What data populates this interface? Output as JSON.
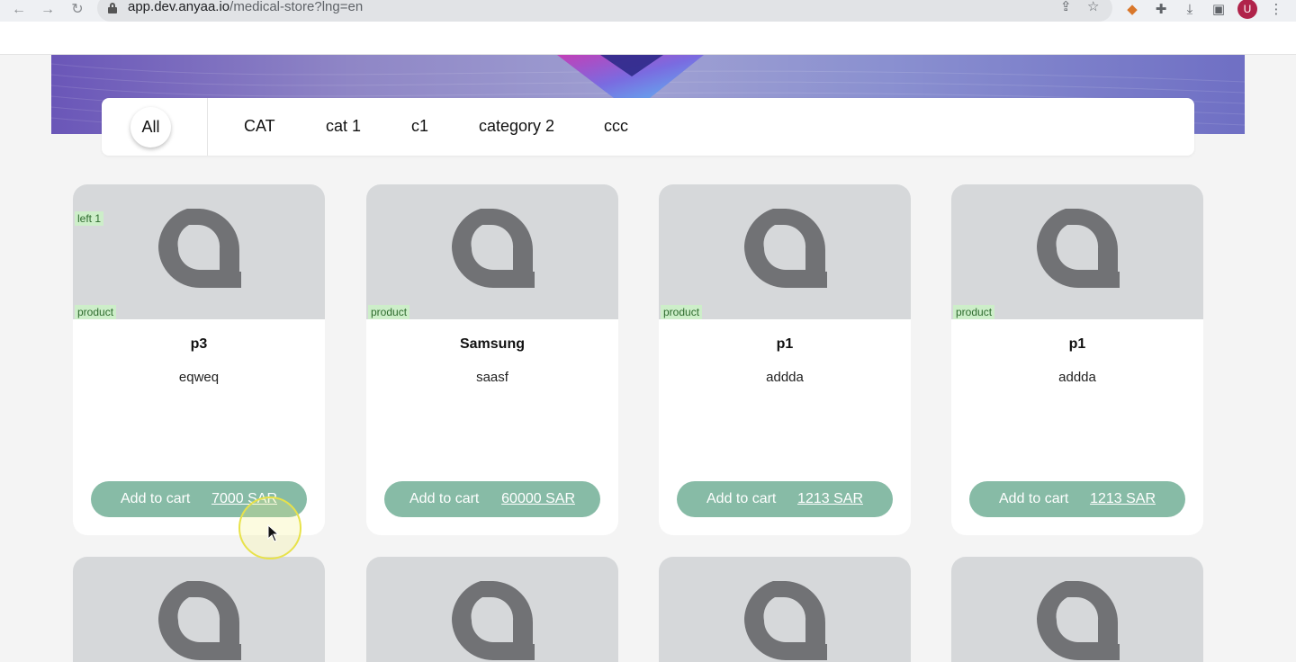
{
  "browser": {
    "url_host": "app.dev.anyaa.io",
    "url_path": "/medical-store?lng=en",
    "avatar_letter": "U",
    "icons": [
      "back-arrow-icon",
      "forward-arrow-icon",
      "reload-icon",
      "lock-icon",
      "share-icon",
      "star-icon",
      "fox-extension-icon",
      "puzzle-extension-icon",
      "download-icon",
      "side-panel-icon",
      "kebab-menu-icon"
    ]
  },
  "categories": {
    "selected": "All",
    "items": [
      "CAT",
      "cat 1",
      "c1",
      "category 2",
      "ccc"
    ]
  },
  "products": [
    {
      "stock_badge": "left 1",
      "type_badge": "product",
      "title": "p3",
      "description": "eqweq",
      "cart_label": "Add to cart",
      "price": "7000 SAR"
    },
    {
      "stock_badge": "",
      "type_badge": "product",
      "title": "Samsung",
      "description": "saasf",
      "cart_label": "Add to cart",
      "price": "60000 SAR"
    },
    {
      "stock_badge": "",
      "type_badge": "product",
      "title": "p1",
      "description": "addda",
      "cart_label": "Add to cart",
      "price": "1213 SAR"
    },
    {
      "stock_badge": "",
      "type_badge": "product",
      "title": "p1",
      "description": "addda",
      "cart_label": "Add to cart",
      "price": "1213 SAR"
    }
  ],
  "colors": {
    "cart_button": "#87bba6",
    "badge_bg": "#cdeec9",
    "badge_text": "#2e6b2e",
    "image_placeholder": "#d6d8da",
    "logo_gray": "#717275"
  }
}
